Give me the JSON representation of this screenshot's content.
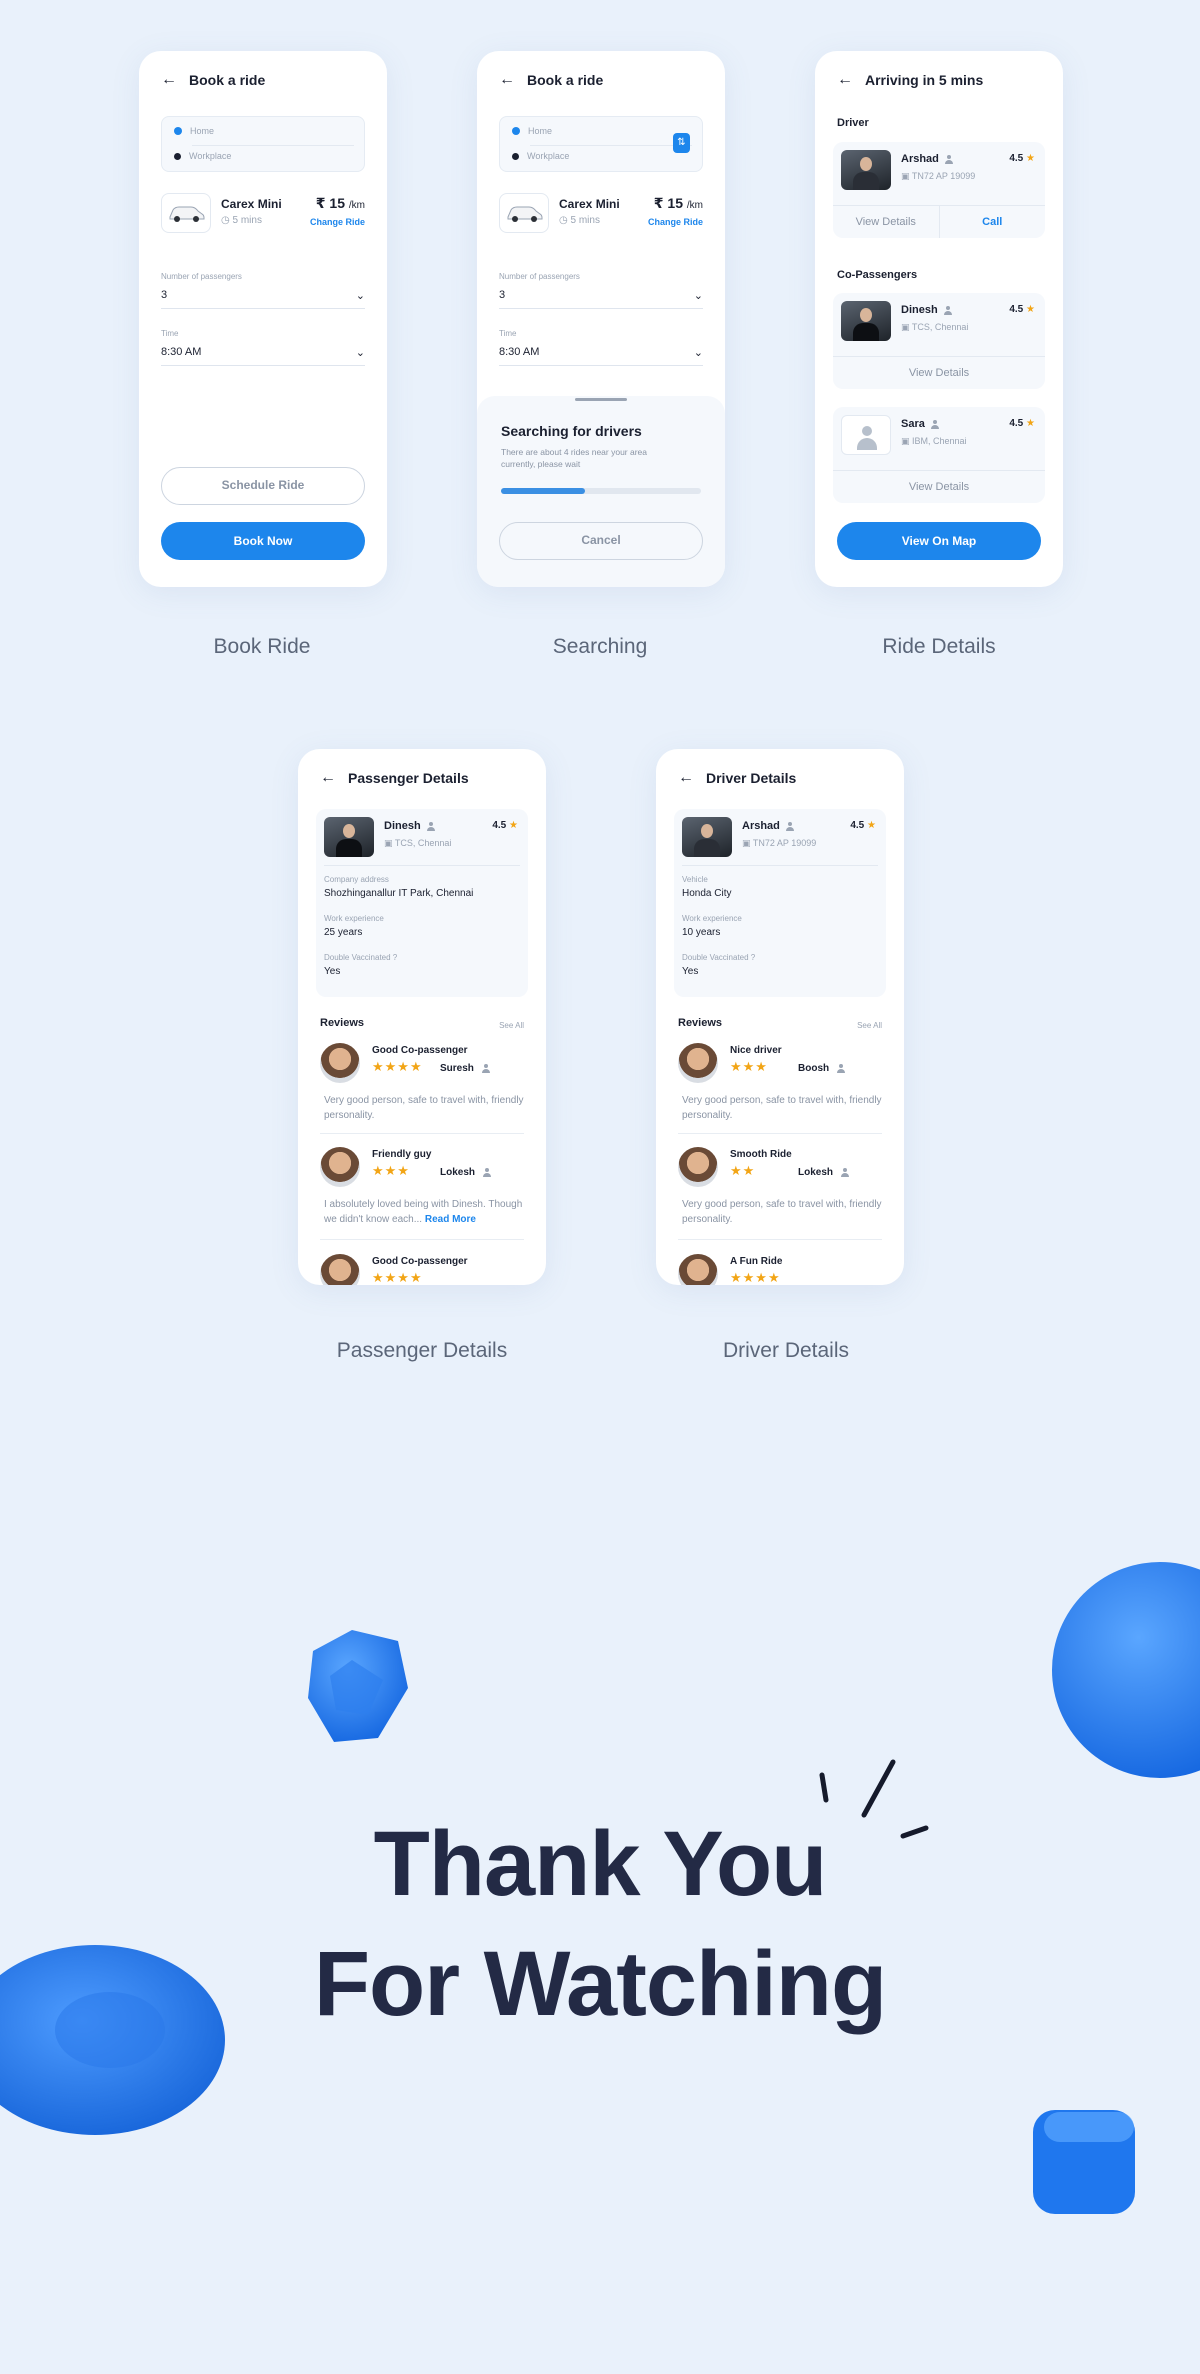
{
  "screens": {
    "book": {
      "title": "Book a ride",
      "from": "Home",
      "to": "Workplace",
      "car_name": "Carex Mini",
      "car_time": "5 mins",
      "price": "₹ 15",
      "price_unit": "/km",
      "change_ride": "Change Ride",
      "passengers_label": "Number of passengers",
      "passengers_value": "3",
      "time_label": "Time",
      "time_value": "8:30 AM",
      "schedule_label": "Schedule Ride",
      "book_label": "Book Now",
      "caption": "Book Ride"
    },
    "search": {
      "title": "Book a ride",
      "from": "Home",
      "to": "Workplace",
      "car_name": "Carex Mini",
      "car_time": "5 mins",
      "price": "₹ 15",
      "price_unit": "/km",
      "change_ride": "Change Ride",
      "passengers_label": "Number of passengers",
      "passengers_value": "3",
      "time_label": "Time",
      "time_value": "8:30 AM",
      "sheet_title": "Searching for drivers",
      "sheet_text": "There are about 4 rides near your area currently, please wait",
      "progress": 0.42,
      "cancel_label": "Cancel",
      "caption": "Searching"
    },
    "ride": {
      "title": "Arriving in 5 mins",
      "driver_section": "Driver",
      "driver_name": "Arshad",
      "driver_plate": "TN72 AP 19099",
      "driver_rating": "4.5",
      "view_details": "View Details",
      "call": "Call",
      "copass_section": "Co-Passengers",
      "p1_name": "Dinesh",
      "p1_sub": "TCS, Chennai",
      "p1_rating": "4.5",
      "p2_name": "Sara",
      "p2_sub": "IBM, Chennai",
      "p2_rating": "4.5",
      "map_label": "View On Map",
      "caption": "Ride Details"
    },
    "passenger": {
      "title": "Passenger Details",
      "name": "Dinesh",
      "sub": "TCS, Chennai",
      "rating": "4.5",
      "k1": "Company address",
      "v1": "Shozhinganallur IT Park, Chennai",
      "k2": "Work experience",
      "v2": "25 years",
      "k3": "Double Vaccinated ?",
      "v3": "Yes",
      "reviews": "Reviews",
      "see_all": "See All",
      "r1_title": "Good Co-passenger",
      "r1_stars": "★★★★",
      "r1_name": "Suresh",
      "r1_text": "Very good person, safe to travel with, friendly personality.",
      "r2_title": "Friendly guy",
      "r2_stars": "★★★",
      "r2_name": "Lokesh",
      "r2_text": "I absolutely loved being with Dinesh. Though we didn't know each...",
      "r2_more": "Read More",
      "r3_title": "Good Co-passenger",
      "r3_stars": "★★★★",
      "caption": "Passenger Details"
    },
    "driver": {
      "title": "Driver Details",
      "name": "Arshad",
      "sub": "TN72 AP 19099",
      "rating": "4.5",
      "k1": "Vehicle",
      "v1": "Honda City",
      "k2": "Work experience",
      "v2": "10 years",
      "k3": "Double Vaccinated ?",
      "v3": "Yes",
      "reviews": "Reviews",
      "see_all": "See All",
      "r1_title": "Nice driver",
      "r1_stars": "★★★",
      "r1_name": "Boosh",
      "r1_text": "Very good person, safe to travel with, friendly personality.",
      "r2_title": "Smooth Ride",
      "r2_stars": "★★",
      "r2_name": "Lokesh",
      "r2_text": "Very good person, safe to travel with, friendly personality.",
      "r3_title": "A Fun Ride",
      "r3_stars": "★★★★",
      "caption": "Driver Details"
    }
  },
  "thanks": {
    "line1": "Thank You",
    "line2": "For Watching"
  },
  "colors": {
    "accent": "#1d86ec",
    "background": "#e9f1fb",
    "star": "#f2a516",
    "heading": "#232a45"
  }
}
